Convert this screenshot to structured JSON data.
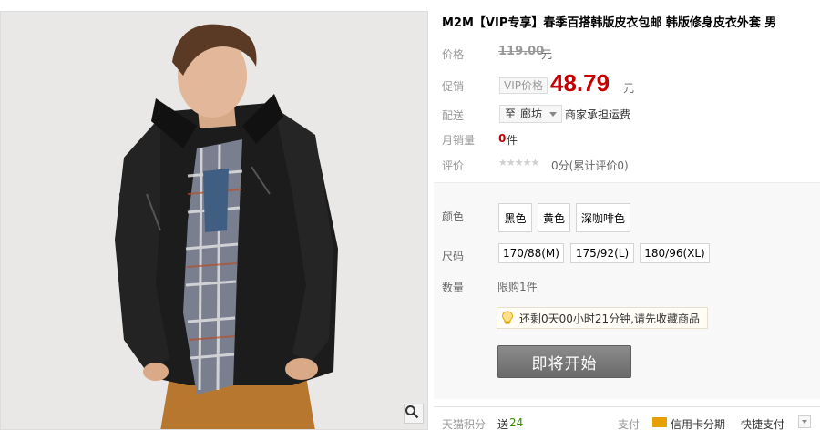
{
  "product": {
    "title": "M2M【VIP专享】春季百搭韩版皮衣包邮 韩版修身皮衣外套 男"
  },
  "price": {
    "label": "价格",
    "original": "119.00",
    "unit": "元"
  },
  "promo": {
    "label": "促销",
    "tag": "VIP价格",
    "value": "48.79",
    "unit": "元"
  },
  "shipping": {
    "label": "配送",
    "prefix": "至",
    "location": "廊坊",
    "note": "商家承担运费"
  },
  "sales": {
    "label": "月销量",
    "count": "0",
    "unit": "件"
  },
  "review": {
    "label": "评价",
    "stars": "★★★★★",
    "text": "0分(累计评价0)"
  },
  "options": {
    "color_label": "颜色",
    "colors": [
      "黑色",
      "黄色",
      "深咖啡色"
    ],
    "size_label": "尺码",
    "sizes": [
      "170/88(M)",
      "175/92(L)",
      "180/96(XL)"
    ],
    "qty_label": "数量",
    "limit": "限购1件",
    "tip": "还剩0天00小时21分钟,请先收藏商品",
    "button": "即将开始"
  },
  "bottom": {
    "points_label": "天猫积分",
    "points_prefix": "送",
    "points_value": "24",
    "pay_label": "支付",
    "pay_credit": "信用卡分期",
    "pay_quick": "快捷支付"
  },
  "colors": {
    "price_red": "#c40000",
    "button_gray": "#7a7a7a",
    "panel_bg": "#f8f8f8"
  }
}
